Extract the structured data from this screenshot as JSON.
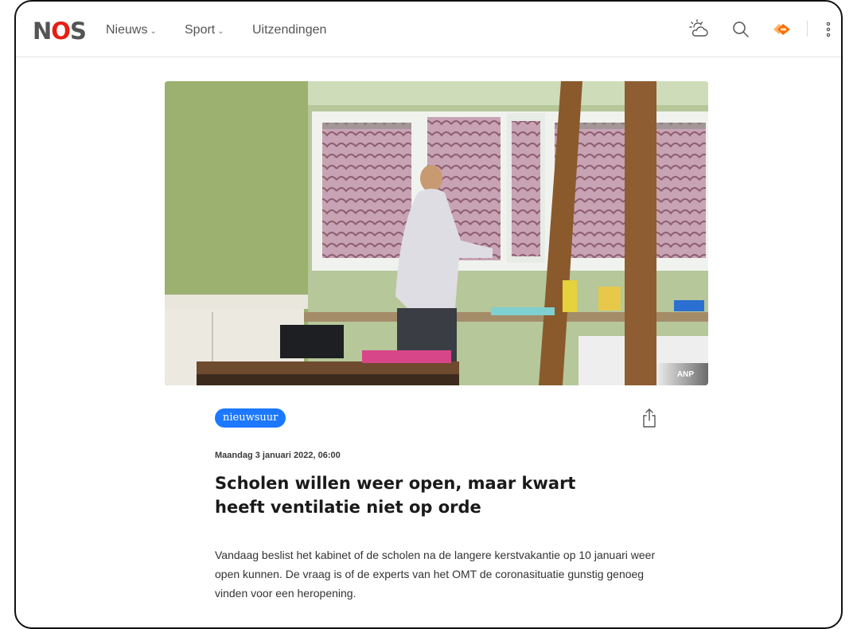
{
  "header": {
    "logo_n": "N",
    "logo_o": "O",
    "logo_s": "S",
    "nav": [
      {
        "label": "Nieuws",
        "has_dropdown": true
      },
      {
        "label": "Sport",
        "has_dropdown": true
      },
      {
        "label": "Uitzendingen",
        "has_dropdown": false
      }
    ],
    "icons": [
      "weather-icon",
      "search-icon",
      "npo-logo-icon",
      "more-vertical-icon"
    ]
  },
  "article": {
    "image_credit": "ANP",
    "tag": "nieuwsuur",
    "date": "Maandag 3 januari 2022, 06:00",
    "title": "Scholen willen weer open, maar kwart heeft ventilatie niet op orde",
    "lead": "Vandaag beslist het kabinet of de scholen na de langere kerstvakantie op 10 januari weer open kunnen. De vraag is of de experts van het OMT de coronasituatie gunstig genoeg vinden voor een heropening."
  },
  "colors": {
    "brand_red": "#e61e14",
    "tag_blue": "#1c78ff",
    "npo_orange": "#ff6d00"
  }
}
